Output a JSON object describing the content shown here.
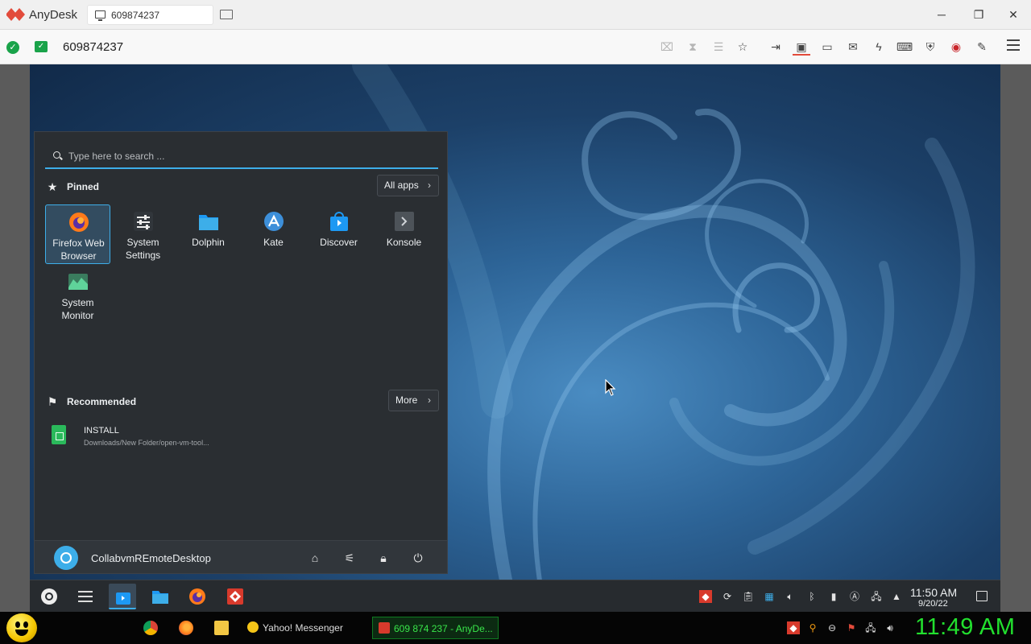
{
  "anydesk": {
    "app_name": "AnyDesk",
    "tab_label": "609874237",
    "session_id": "609874237",
    "accent": "#e24b3b"
  },
  "launcher": {
    "search_placeholder": "Type here to search ...",
    "pinned_title": "Pinned",
    "all_apps_label": "All apps",
    "pinned_apps": [
      {
        "label": "Firefox Web Browser",
        "icon": "firefox-icon"
      },
      {
        "label": "System Settings",
        "icon": "system-settings-icon"
      },
      {
        "label": "Dolphin",
        "icon": "dolphin-folder-icon"
      },
      {
        "label": "Kate",
        "icon": "kate-icon"
      },
      {
        "label": "Discover",
        "icon": "discover-icon"
      },
      {
        "label": "Konsole",
        "icon": "konsole-icon"
      },
      {
        "label": "System Monitor",
        "icon": "system-monitor-icon"
      }
    ],
    "recommended_title": "Recommended",
    "more_label": "More",
    "recommended": [
      {
        "name": "INSTALL",
        "path": "Downloads/New Folder/open-vm-tool..."
      }
    ],
    "user_name": "CollabvmREmoteDesktop"
  },
  "kde_panel": {
    "time": "11:50 AM",
    "date": "9/20/22"
  },
  "win_taskbar": {
    "yahoo_label": "Yahoo! Messenger",
    "anydesk_label": "609 874 237 - AnyDe...",
    "clock": "11:49 AM"
  }
}
